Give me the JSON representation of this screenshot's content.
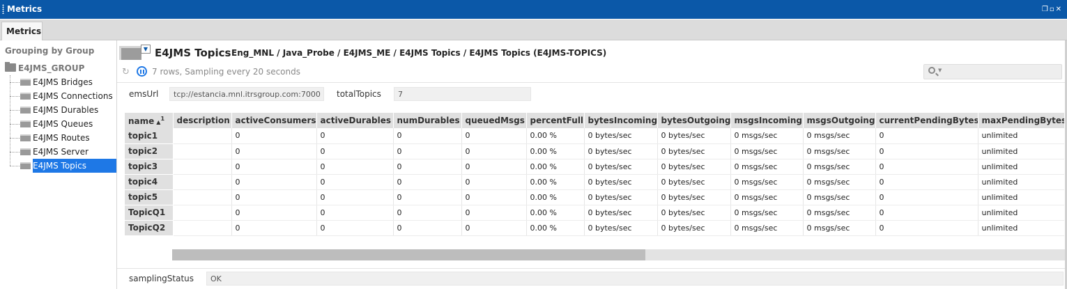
{
  "window": {
    "title": "Metrics"
  },
  "tabs": [
    {
      "label": "Metrics"
    }
  ],
  "sidebar": {
    "heading": "Grouping by Group",
    "root": "E4JMS_GROUP",
    "items": [
      {
        "label": "E4JMS Bridges"
      },
      {
        "label": "E4JMS Connections"
      },
      {
        "label": "E4JMS Durables"
      },
      {
        "label": "E4JMS Queues"
      },
      {
        "label": "E4JMS Routes"
      },
      {
        "label": "E4JMS Server"
      },
      {
        "label": "E4JMS Topics"
      }
    ]
  },
  "header": {
    "title": "E4JMS Topics",
    "path": "Eng_MNL / Java_Probe / E4JMS_ME / E4JMS Topics / E4JMS Topics (E4JMS-TOPICS)",
    "status": "7 rows, Sampling every 20 seconds",
    "search_placeholder": ""
  },
  "headlines": {
    "emsUrl_label": "emsUrl",
    "emsUrl_value": "tcp://estancia.mnl.itrsgroup.com:7000",
    "totalTopics_label": "totalTopics",
    "totalTopics_value": "7",
    "samplingStatus_label": "samplingStatus",
    "samplingStatus_value": "OK"
  },
  "table": {
    "sort_index": "1",
    "columns": [
      "name",
      "description",
      "activeConsumers",
      "activeDurables",
      "numDurables",
      "queuedMsgs",
      "percentFull",
      "bytesIncoming",
      "bytesOutgoing",
      "msgsIncoming",
      "msgsOutgoing",
      "currentPendingBytes",
      "maxPendingBytes"
    ],
    "rows": [
      [
        "topic1",
        "",
        "0",
        "0",
        "0",
        "0",
        "0.00 %",
        "0 bytes/sec",
        "0 bytes/sec",
        "0 msgs/sec",
        "0 msgs/sec",
        "0",
        "unlimited"
      ],
      [
        "topic2",
        "",
        "0",
        "0",
        "0",
        "0",
        "0.00 %",
        "0 bytes/sec",
        "0 bytes/sec",
        "0 msgs/sec",
        "0 msgs/sec",
        "0",
        "unlimited"
      ],
      [
        "topic3",
        "",
        "0",
        "0",
        "0",
        "0",
        "0.00 %",
        "0 bytes/sec",
        "0 bytes/sec",
        "0 msgs/sec",
        "0 msgs/sec",
        "0",
        "unlimited"
      ],
      [
        "topic4",
        "",
        "0",
        "0",
        "0",
        "0",
        "0.00 %",
        "0 bytes/sec",
        "0 bytes/sec",
        "0 msgs/sec",
        "0 msgs/sec",
        "0",
        "unlimited"
      ],
      [
        "topic5",
        "",
        "0",
        "0",
        "0",
        "0",
        "0.00 %",
        "0 bytes/sec",
        "0 bytes/sec",
        "0 msgs/sec",
        "0 msgs/sec",
        "0",
        "unlimited"
      ],
      [
        "TopicQ1",
        "",
        "0",
        "0",
        "0",
        "0",
        "0.00 %",
        "0 bytes/sec",
        "0 bytes/sec",
        "0 msgs/sec",
        "0 msgs/sec",
        "0",
        "unlimited"
      ],
      [
        "TopicQ2",
        "",
        "0",
        "0",
        "0",
        "0",
        "0.00 %",
        "0 bytes/sec",
        "0 bytes/sec",
        "0 msgs/sec",
        "0 msgs/sec",
        "0",
        "unlimited"
      ]
    ]
  },
  "scroll": {
    "horizontal_thumb_fraction": 0.53
  },
  "colors": {
    "titlebar": "#0b58a8",
    "selection": "#1e78e6"
  }
}
